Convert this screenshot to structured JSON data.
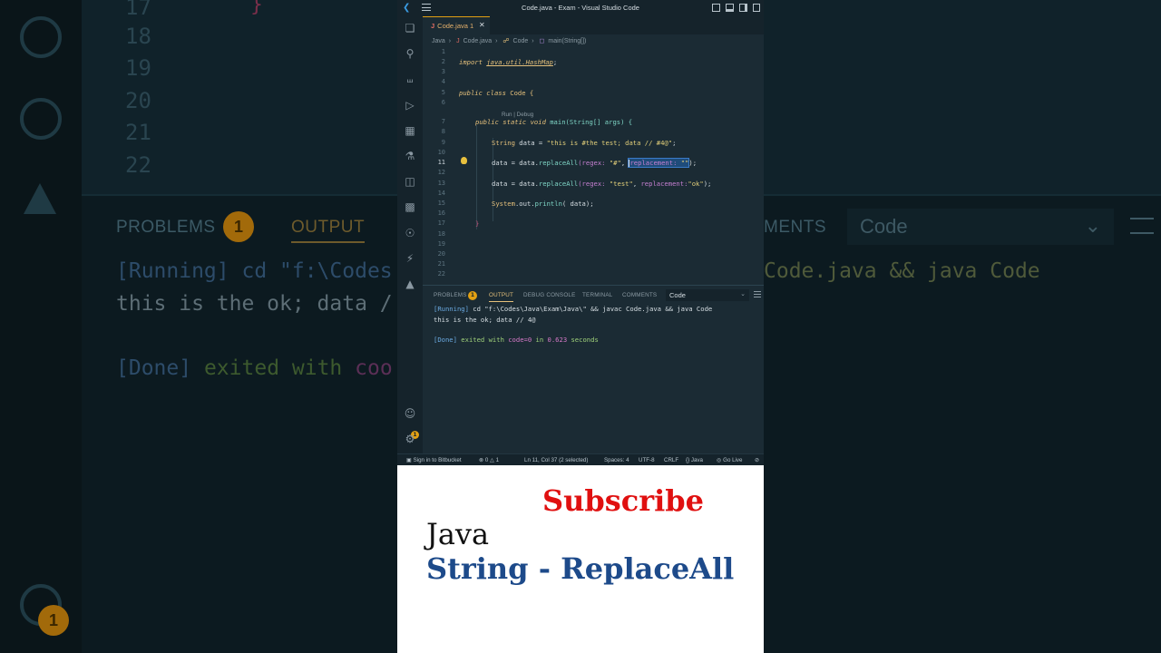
{
  "window": {
    "title": "Code.java - Exam - Visual Studio Code"
  },
  "tab": {
    "label": "Code.java",
    "badge": "1"
  },
  "breadcrumb": [
    "Java",
    "Code.java",
    "Code",
    "main(String[])"
  ],
  "editor": {
    "line_numbers": [
      "1",
      "2",
      "3",
      "4",
      "5",
      "6",
      "7",
      "8",
      "9",
      "10",
      "11",
      "12",
      "13",
      "14",
      "15",
      "16",
      "17",
      "18",
      "19",
      "20",
      "21",
      "22"
    ],
    "codelens": "Run | Debug",
    "lines": {
      "l2_kw": "import",
      "l2_pkg": "java.util.HashMap",
      "l2_end": ";",
      "l5_kw": "public class",
      "l5_name": "Code {",
      "l7_kw": "public static void",
      "l7_rest": "main(String[] args) {",
      "l9_type": "String",
      "l9_rest": "data = ",
      "l9_str": "\"this is #the test; data // #4@\"",
      "l9_end": ";",
      "l11_pre": "data = data.",
      "l11_fn": "replaceAll",
      "l11_hint1": "(regex:",
      "l11_str1": "\"#\"",
      "l11_comma": ",",
      "l11_hint2": "replacement:",
      "l11_str2": "\"\"",
      "l11_end": ");",
      "l13_pre": "data = data.",
      "l13_fn": "replaceAll",
      "l13_hint1": "(regex:",
      "l13_str1": "\"test\"",
      "l13_comma": ",",
      "l13_hint2": "replacement:",
      "l13_str2": "\"ok\"",
      "l13_end": ");",
      "l15_sys": "System",
      "l15_mid": ".out.",
      "l15_fn": "println",
      "l15_rest": "( data);",
      "l17": "}"
    }
  },
  "panel": {
    "tabs": [
      "PROBLEMS",
      "OUTPUT",
      "DEBUG CONSOLE",
      "TERMINAL",
      "COMMENTS"
    ],
    "problems_badge": "1",
    "select_value": "Code",
    "output": {
      "run_tag": "[Running]",
      "run_cmd": "cd \"f:\\Codes\\Java\\Exam\\Java\\\" && javac Code.java && java Code",
      "result": "this is the ok; data // 4@",
      "done_tag": "[Done]",
      "done_text1": "exited with",
      "done_code": "code=0",
      "done_text2": "in",
      "done_secs": "0.623",
      "done_text3": "seconds"
    }
  },
  "statusbar": {
    "remote": "Sign in to Bitbucket",
    "errors": "0",
    "warnings": "1",
    "position": "Ln 11, Col 37 (2 selected)",
    "spaces": "Spaces: 4",
    "encoding": "UTF-8",
    "eol": "CRLF",
    "language": "Java",
    "golive": "Go Live"
  },
  "promo": {
    "subscribe": "Subscribe",
    "line1": "Java",
    "line2": "String - ReplaceAll"
  },
  "background": {
    "line_numbers": [
      "17",
      "18",
      "19",
      "20",
      "21",
      "22"
    ],
    "tabs": [
      "PROBLEMS",
      "OUTPUT",
      "MENTS"
    ],
    "problems_badge": "1",
    "select_value": "Code",
    "run_line_left": "[Running] cd \"f:\\Codes",
    "run_line_right": "Code.java && java Code",
    "result_line": "this is the ok; data /",
    "done_tag": "[Done]",
    "done_text": "exited with",
    "done_code": "coo",
    "account_badge": "1"
  },
  "colors": {
    "accent": "#e2a013",
    "subscribe": "#e01010",
    "topic": "#1d4a8a",
    "editor_bg": "#1b2b34"
  },
  "icons": [
    "files-icon",
    "search-icon",
    "source-control-icon",
    "run-debug-icon",
    "extensions-icon",
    "testing-icon",
    "bookmark-icon",
    "terminal-icon",
    "remote-icon",
    "lightning-icon",
    "atlassian-icon",
    "account-icon",
    "settings-icon"
  ]
}
